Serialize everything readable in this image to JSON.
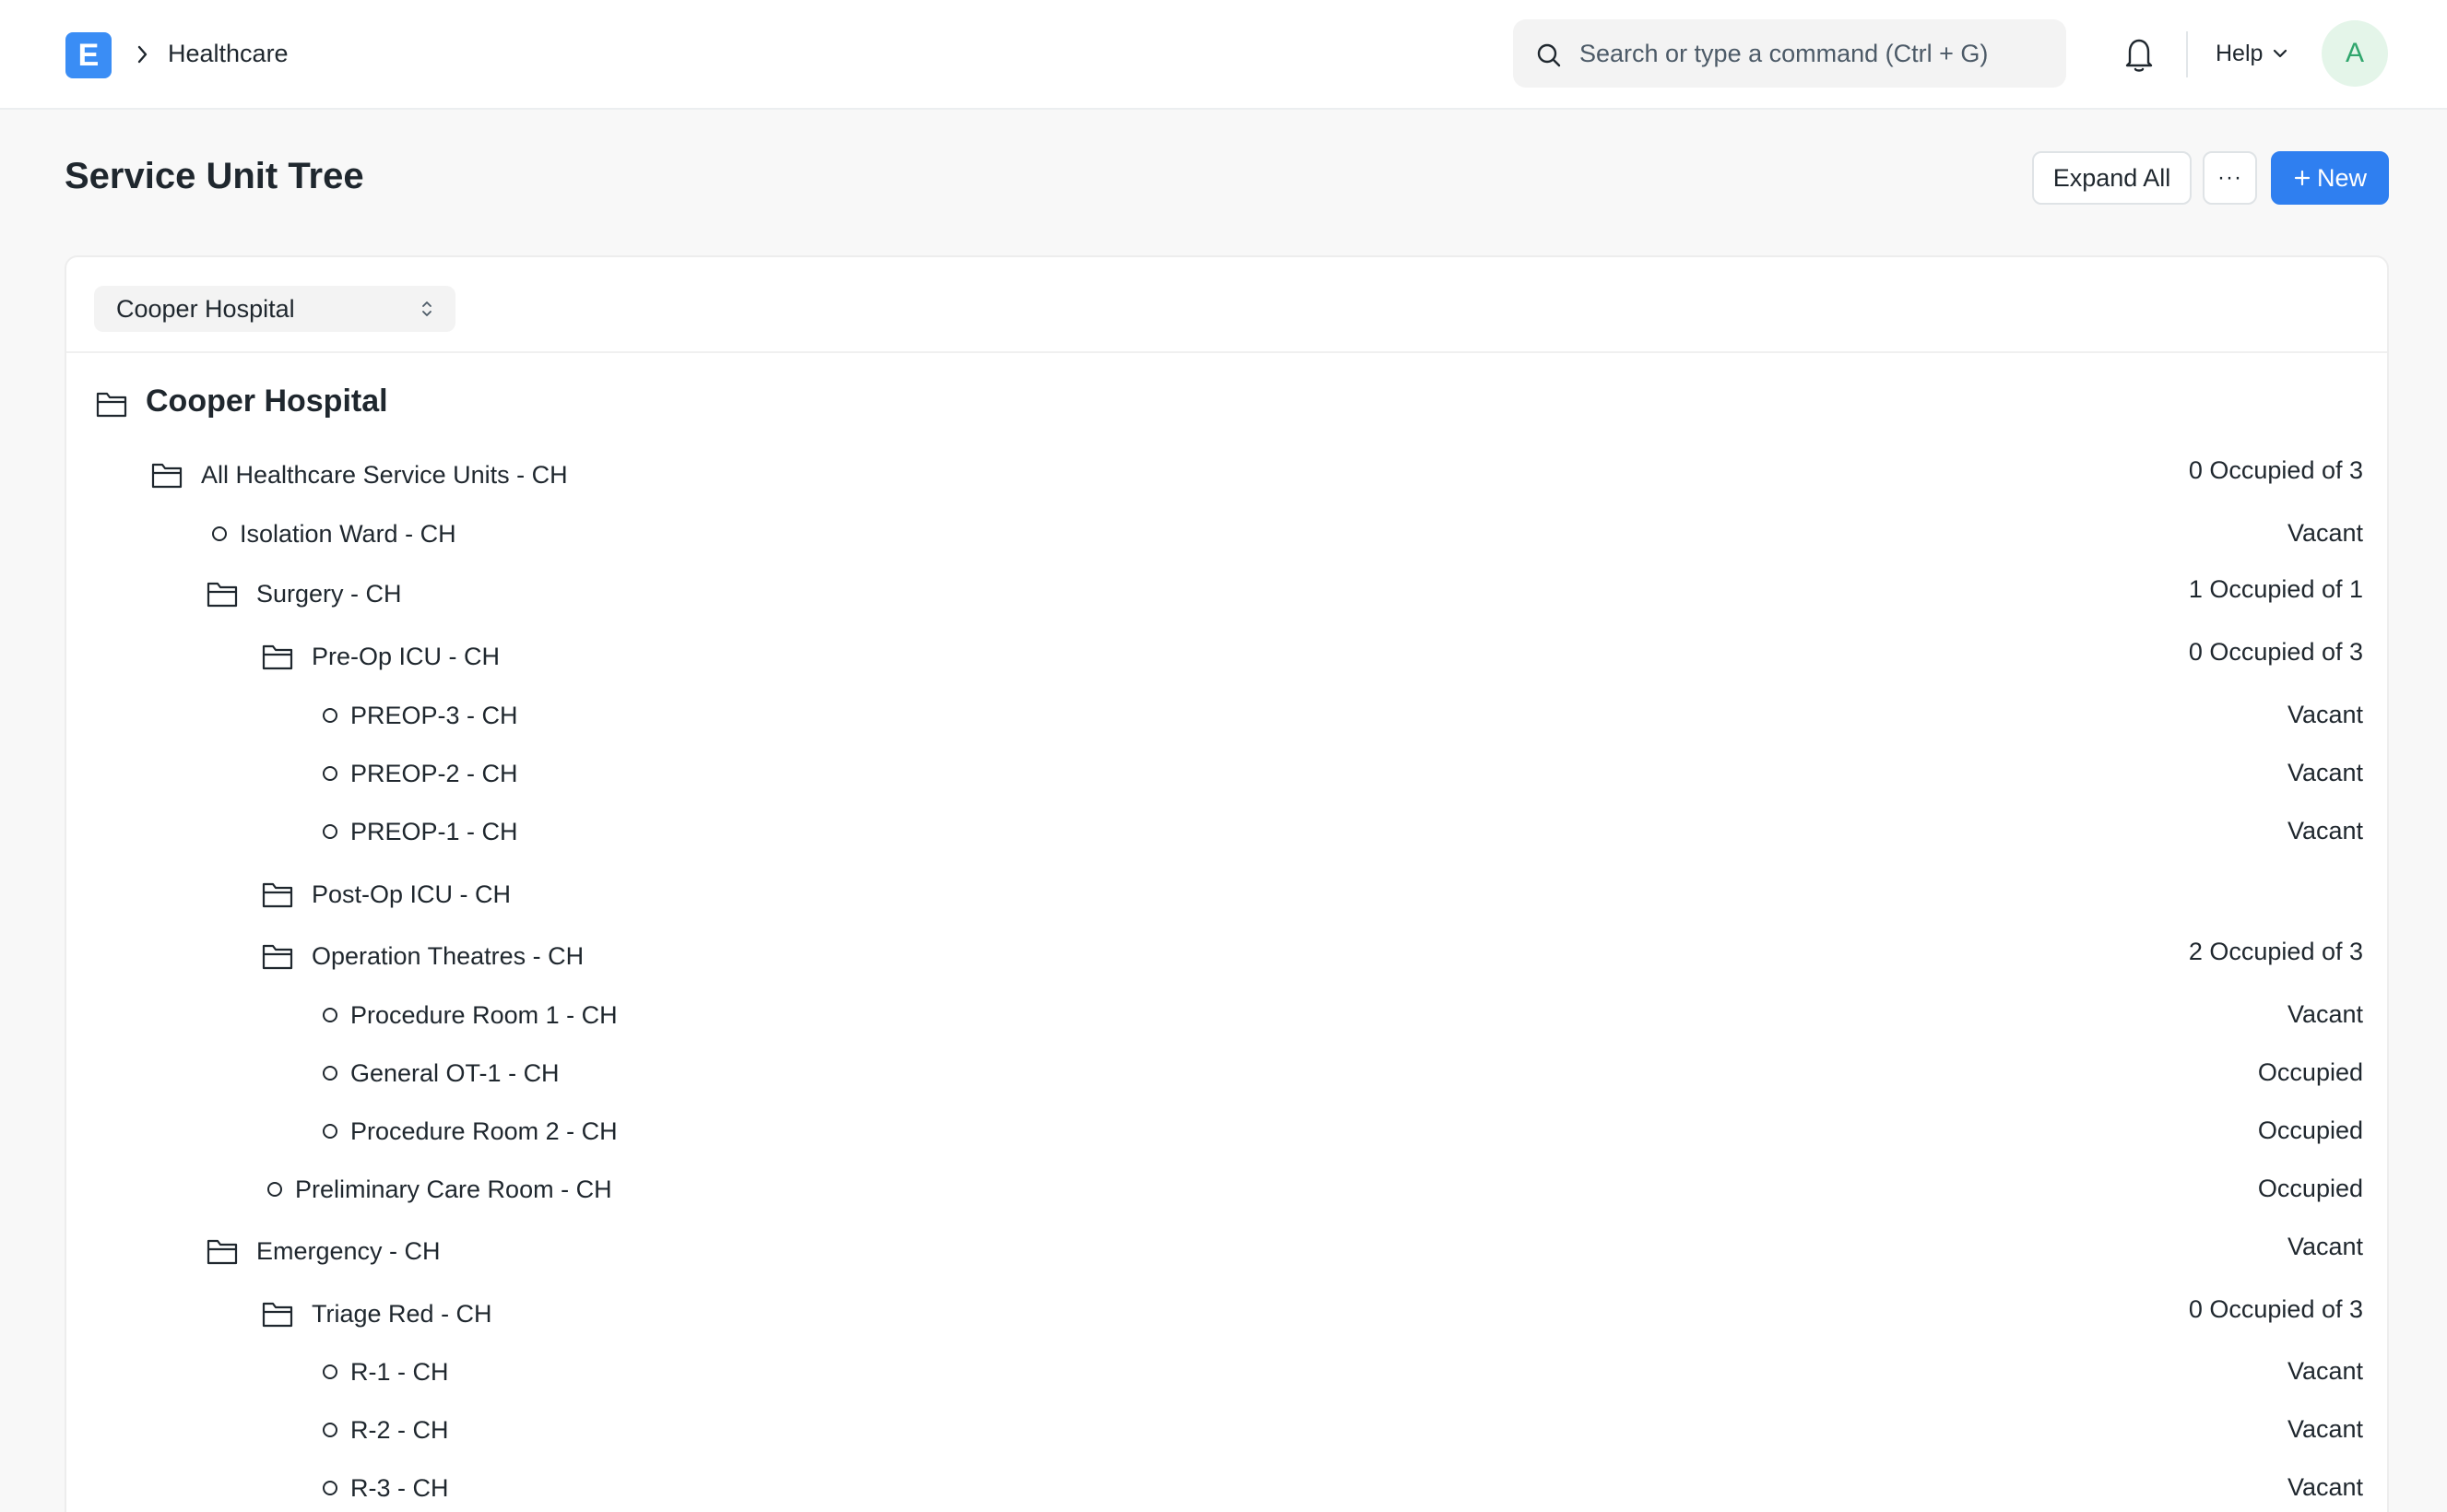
{
  "navbar": {
    "logo_letter": "E",
    "breadcrumb": "Healthcare",
    "search_placeholder": "Search or type a command (Ctrl + G)",
    "help_label": "Help",
    "avatar_initial": "A"
  },
  "page": {
    "title": "Service Unit Tree",
    "expand_all_label": "Expand All",
    "more_label": "···",
    "new_label": "New"
  },
  "filter": {
    "company_selected": "Cooper Hospital"
  },
  "tree": {
    "root": "Cooper Hospital",
    "nodes": [
      {
        "label": "All Healthcare Service Units - CH",
        "status": "0 Occupied of 3",
        "type": "group",
        "depth": 1
      },
      {
        "label": "Isolation Ward - CH",
        "status": "Vacant",
        "type": "leaf",
        "depth": 2
      },
      {
        "label": "Surgery - CH",
        "status": "1 Occupied of 1",
        "type": "group",
        "depth": 2
      },
      {
        "label": "Pre-Op ICU - CH",
        "status": "0 Occupied of 3",
        "type": "group",
        "depth": 3
      },
      {
        "label": "PREOP-3 - CH",
        "status": "Vacant",
        "type": "leaf",
        "depth": 4
      },
      {
        "label": "PREOP-2 - CH",
        "status": "Vacant",
        "type": "leaf",
        "depth": 4
      },
      {
        "label": "PREOP-1 - CH",
        "status": "Vacant",
        "type": "leaf",
        "depth": 4
      },
      {
        "label": "Post-Op ICU - CH",
        "status": "",
        "type": "group",
        "depth": 3
      },
      {
        "label": "Operation Theatres - CH",
        "status": "2 Occupied of 3",
        "type": "group",
        "depth": 3
      },
      {
        "label": "Procedure Room 1 - CH",
        "status": "Vacant",
        "type": "leaf",
        "depth": 4
      },
      {
        "label": "General OT-1 - CH",
        "status": "Occupied",
        "type": "leaf",
        "depth": 4
      },
      {
        "label": "Procedure Room 2 - CH",
        "status": "Occupied",
        "type": "leaf",
        "depth": 4
      },
      {
        "label": "Preliminary Care Room - CH",
        "status": "Occupied",
        "type": "leaf",
        "depth": 3
      },
      {
        "label": "Emergency - CH",
        "status": "Vacant",
        "type": "group",
        "depth": 2
      },
      {
        "label": "Triage Red - CH",
        "status": "0 Occupied of 3",
        "type": "group",
        "depth": 3
      },
      {
        "label": "R-1 - CH",
        "status": "Vacant",
        "type": "leaf",
        "depth": 4
      },
      {
        "label": "R-2 - CH",
        "status": "Vacant",
        "type": "leaf",
        "depth": 4
      },
      {
        "label": "R-3 - CH",
        "status": "Vacant",
        "type": "leaf",
        "depth": 4
      }
    ]
  }
}
